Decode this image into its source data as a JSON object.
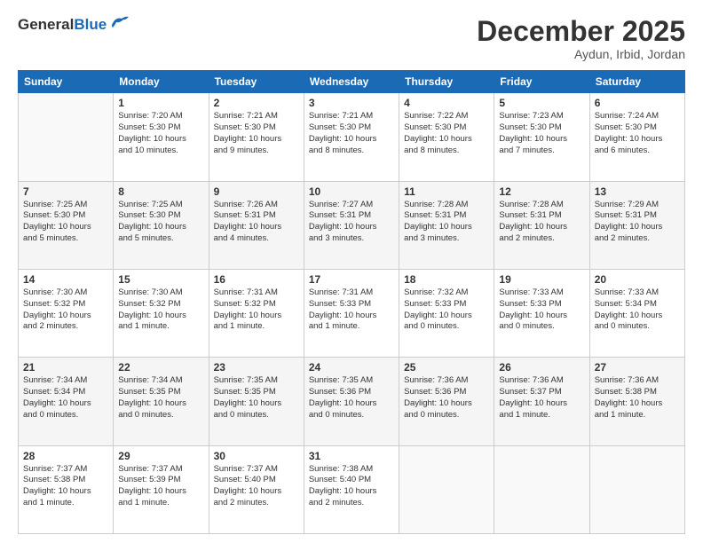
{
  "header": {
    "logo_general": "General",
    "logo_blue": "Blue",
    "month_title": "December 2025",
    "location": "Aydun, Irbid, Jordan"
  },
  "days_of_week": [
    "Sunday",
    "Monday",
    "Tuesday",
    "Wednesday",
    "Thursday",
    "Friday",
    "Saturday"
  ],
  "weeks": [
    [
      {
        "day": "",
        "info": ""
      },
      {
        "day": "1",
        "info": "Sunrise: 7:20 AM\nSunset: 5:30 PM\nDaylight: 10 hours\nand 10 minutes."
      },
      {
        "day": "2",
        "info": "Sunrise: 7:21 AM\nSunset: 5:30 PM\nDaylight: 10 hours\nand 9 minutes."
      },
      {
        "day": "3",
        "info": "Sunrise: 7:21 AM\nSunset: 5:30 PM\nDaylight: 10 hours\nand 8 minutes."
      },
      {
        "day": "4",
        "info": "Sunrise: 7:22 AM\nSunset: 5:30 PM\nDaylight: 10 hours\nand 8 minutes."
      },
      {
        "day": "5",
        "info": "Sunrise: 7:23 AM\nSunset: 5:30 PM\nDaylight: 10 hours\nand 7 minutes."
      },
      {
        "day": "6",
        "info": "Sunrise: 7:24 AM\nSunset: 5:30 PM\nDaylight: 10 hours\nand 6 minutes."
      }
    ],
    [
      {
        "day": "7",
        "info": "Sunrise: 7:25 AM\nSunset: 5:30 PM\nDaylight: 10 hours\nand 5 minutes."
      },
      {
        "day": "8",
        "info": "Sunrise: 7:25 AM\nSunset: 5:30 PM\nDaylight: 10 hours\nand 5 minutes."
      },
      {
        "day": "9",
        "info": "Sunrise: 7:26 AM\nSunset: 5:31 PM\nDaylight: 10 hours\nand 4 minutes."
      },
      {
        "day": "10",
        "info": "Sunrise: 7:27 AM\nSunset: 5:31 PM\nDaylight: 10 hours\nand 3 minutes."
      },
      {
        "day": "11",
        "info": "Sunrise: 7:28 AM\nSunset: 5:31 PM\nDaylight: 10 hours\nand 3 minutes."
      },
      {
        "day": "12",
        "info": "Sunrise: 7:28 AM\nSunset: 5:31 PM\nDaylight: 10 hours\nand 2 minutes."
      },
      {
        "day": "13",
        "info": "Sunrise: 7:29 AM\nSunset: 5:31 PM\nDaylight: 10 hours\nand 2 minutes."
      }
    ],
    [
      {
        "day": "14",
        "info": "Sunrise: 7:30 AM\nSunset: 5:32 PM\nDaylight: 10 hours\nand 2 minutes."
      },
      {
        "day": "15",
        "info": "Sunrise: 7:30 AM\nSunset: 5:32 PM\nDaylight: 10 hours\nand 1 minute."
      },
      {
        "day": "16",
        "info": "Sunrise: 7:31 AM\nSunset: 5:32 PM\nDaylight: 10 hours\nand 1 minute."
      },
      {
        "day": "17",
        "info": "Sunrise: 7:31 AM\nSunset: 5:33 PM\nDaylight: 10 hours\nand 1 minute."
      },
      {
        "day": "18",
        "info": "Sunrise: 7:32 AM\nSunset: 5:33 PM\nDaylight: 10 hours\nand 0 minutes."
      },
      {
        "day": "19",
        "info": "Sunrise: 7:33 AM\nSunset: 5:33 PM\nDaylight: 10 hours\nand 0 minutes."
      },
      {
        "day": "20",
        "info": "Sunrise: 7:33 AM\nSunset: 5:34 PM\nDaylight: 10 hours\nand 0 minutes."
      }
    ],
    [
      {
        "day": "21",
        "info": "Sunrise: 7:34 AM\nSunset: 5:34 PM\nDaylight: 10 hours\nand 0 minutes."
      },
      {
        "day": "22",
        "info": "Sunrise: 7:34 AM\nSunset: 5:35 PM\nDaylight: 10 hours\nand 0 minutes."
      },
      {
        "day": "23",
        "info": "Sunrise: 7:35 AM\nSunset: 5:35 PM\nDaylight: 10 hours\nand 0 minutes."
      },
      {
        "day": "24",
        "info": "Sunrise: 7:35 AM\nSunset: 5:36 PM\nDaylight: 10 hours\nand 0 minutes."
      },
      {
        "day": "25",
        "info": "Sunrise: 7:36 AM\nSunset: 5:36 PM\nDaylight: 10 hours\nand 0 minutes."
      },
      {
        "day": "26",
        "info": "Sunrise: 7:36 AM\nSunset: 5:37 PM\nDaylight: 10 hours\nand 1 minute."
      },
      {
        "day": "27",
        "info": "Sunrise: 7:36 AM\nSunset: 5:38 PM\nDaylight: 10 hours\nand 1 minute."
      }
    ],
    [
      {
        "day": "28",
        "info": "Sunrise: 7:37 AM\nSunset: 5:38 PM\nDaylight: 10 hours\nand 1 minute."
      },
      {
        "day": "29",
        "info": "Sunrise: 7:37 AM\nSunset: 5:39 PM\nDaylight: 10 hours\nand 1 minute."
      },
      {
        "day": "30",
        "info": "Sunrise: 7:37 AM\nSunset: 5:40 PM\nDaylight: 10 hours\nand 2 minutes."
      },
      {
        "day": "31",
        "info": "Sunrise: 7:38 AM\nSunset: 5:40 PM\nDaylight: 10 hours\nand 2 minutes."
      },
      {
        "day": "",
        "info": ""
      },
      {
        "day": "",
        "info": ""
      },
      {
        "day": "",
        "info": ""
      }
    ]
  ]
}
